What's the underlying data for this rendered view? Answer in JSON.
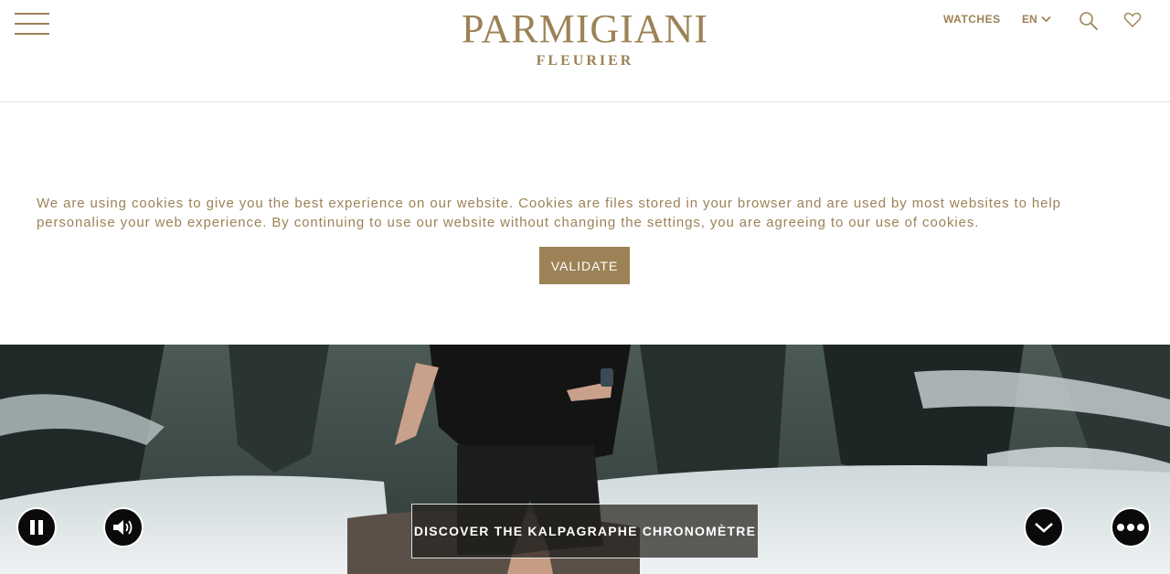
{
  "header": {
    "logo_main": "PARMIGIANI",
    "logo_sub": "FLEURIER",
    "nav_watches": "WATCHES",
    "language": "EN"
  },
  "cookie": {
    "message": "We are using cookies to give you the best experience on our website. Cookies are files stored in your browser and are used by most websites to help personalise your web experience. By continuing to use our website without changing the settings, you are agreeing to our use of cookies.",
    "validate_label": "VALIDATE"
  },
  "hero": {
    "cta_label": "DISCOVER THE KALPAGRAPHE CHRONOMÈTRE",
    "controls": {
      "pause_icon": "pause-icon",
      "sound_icon": "volume-icon",
      "scroll_icon": "chevron-down-icon",
      "more_icon": "more-icon"
    }
  },
  "colors": {
    "brand": "#9c8256",
    "text_white": "#ffffff",
    "control_bg": "#0a0a0a"
  }
}
